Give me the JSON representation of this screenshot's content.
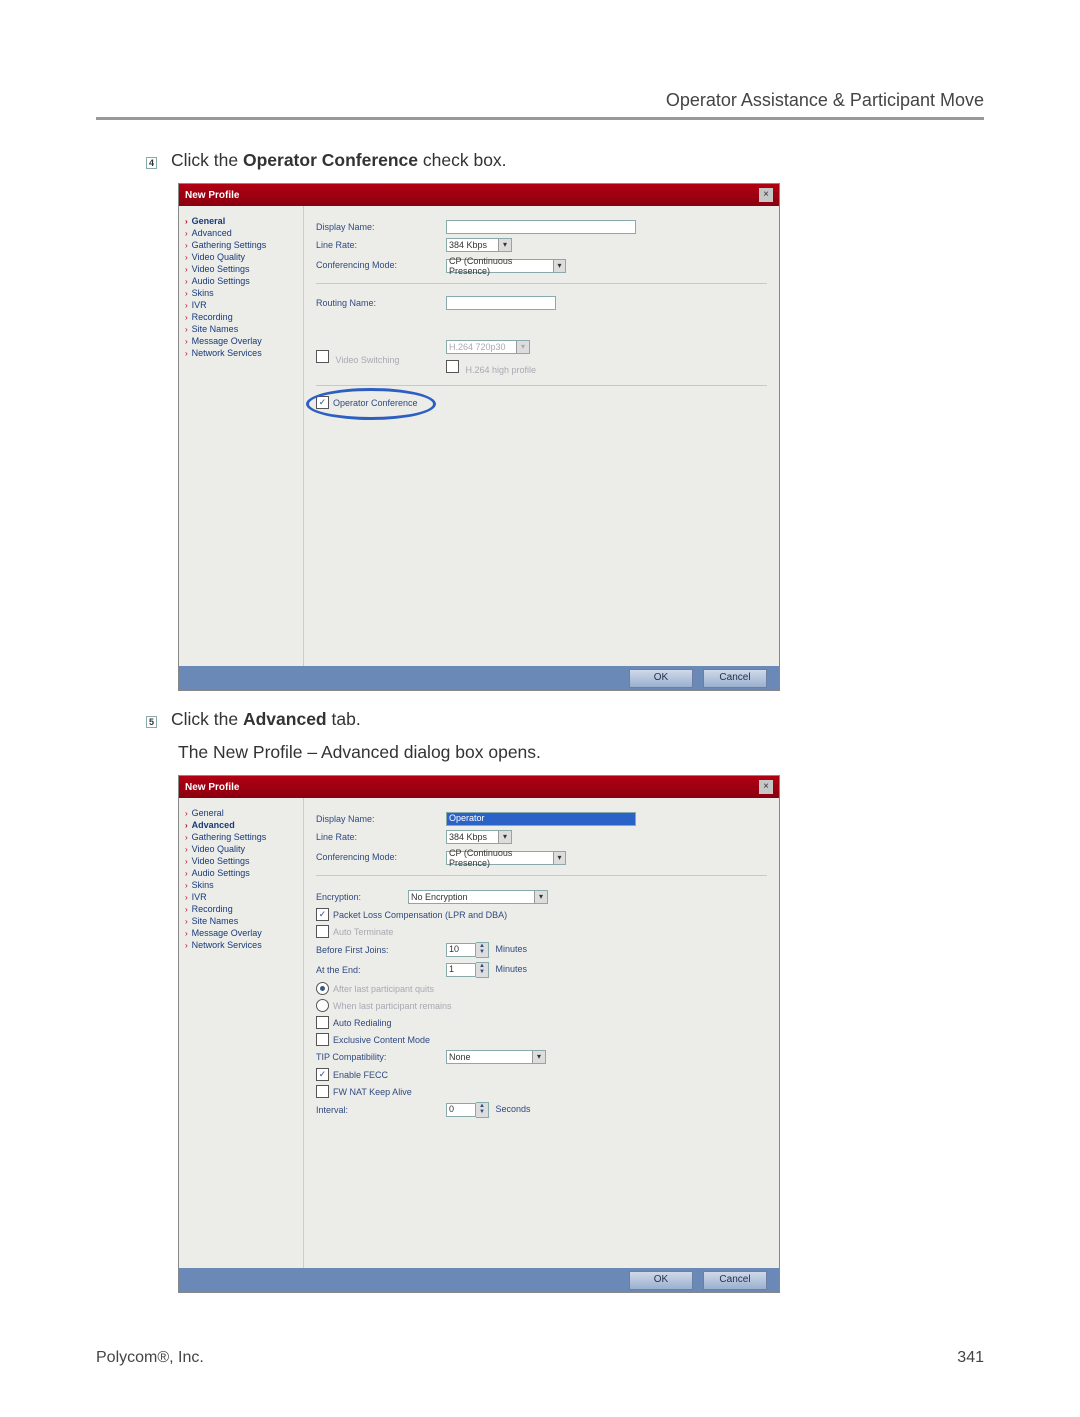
{
  "header": {
    "title": "Operator Assistance & Participant Move"
  },
  "steps": {
    "s4": {
      "num": "4",
      "pre": "Click the ",
      "bold": "Operator Conference",
      "post": " check box."
    },
    "s5": {
      "num": "5",
      "pre": "Click the ",
      "bold": "Advanced",
      "post": " tab."
    },
    "s5b": {
      "pre": "The ",
      "bold": "New Profile – Advanced",
      "post": " dialog box opens."
    }
  },
  "dialog_common": {
    "title": "New Profile",
    "close": "×",
    "ok": "OK",
    "cancel": "Cancel",
    "sidebar": [
      "General",
      "Advanced",
      "Gathering Settings",
      "Video Quality",
      "Video Settings",
      "Audio Settings",
      "Skins",
      "IVR",
      "Recording",
      "Site Names",
      "Message Overlay",
      "Network Services"
    ]
  },
  "dlg1": {
    "active": "General",
    "labels": {
      "display_name": "Display Name:",
      "line_rate": "Line Rate:",
      "conf_mode": "Conferencing Mode:",
      "routing_name": "Routing Name:",
      "video_switching": "Video Switching",
      "op_conf": "Operator Conference",
      "high_profile": "H.264 high profile"
    },
    "values": {
      "display_name": "",
      "line_rate": "384 Kbps",
      "conf_mode": "CP (Continuous Presence)",
      "routing_name": "",
      "hd_sel": "H.264 720p30",
      "op_conf_checked": true
    }
  },
  "dlg2": {
    "active": "Advanced",
    "labels": {
      "display_name": "Display Name:",
      "line_rate": "Line Rate:",
      "conf_mode": "Conferencing Mode:",
      "encryption": "Encryption:",
      "plc": "Packet Loss Compensation (LPR and DBA)",
      "auto_term": "Auto Terminate",
      "before_first": "Before First Joins:",
      "at_end": "At the End:",
      "min1": "Minutes",
      "min2": "Minutes",
      "r_after": "After last participant quits",
      "r_when": "When last participant remains",
      "auto_redial": "Auto Redialing",
      "exclusive": "Exclusive Content Mode",
      "tip": "TIP Compatibility:",
      "fecc": "Enable FECC",
      "fwnat": "FW NAT Keep Alive",
      "interval": "Interval:",
      "seconds": "Seconds"
    },
    "values": {
      "display_name": "Operator",
      "line_rate": "384 Kbps",
      "conf_mode": "CP (Continuous Presence)",
      "encryption": "No Encryption",
      "plc_checked": true,
      "before_first": "10",
      "at_end": "1",
      "r_after": true,
      "tip": "None",
      "fecc": true,
      "interval": "0"
    }
  },
  "footer": {
    "left": "Polycom®, Inc.",
    "right": "341"
  }
}
